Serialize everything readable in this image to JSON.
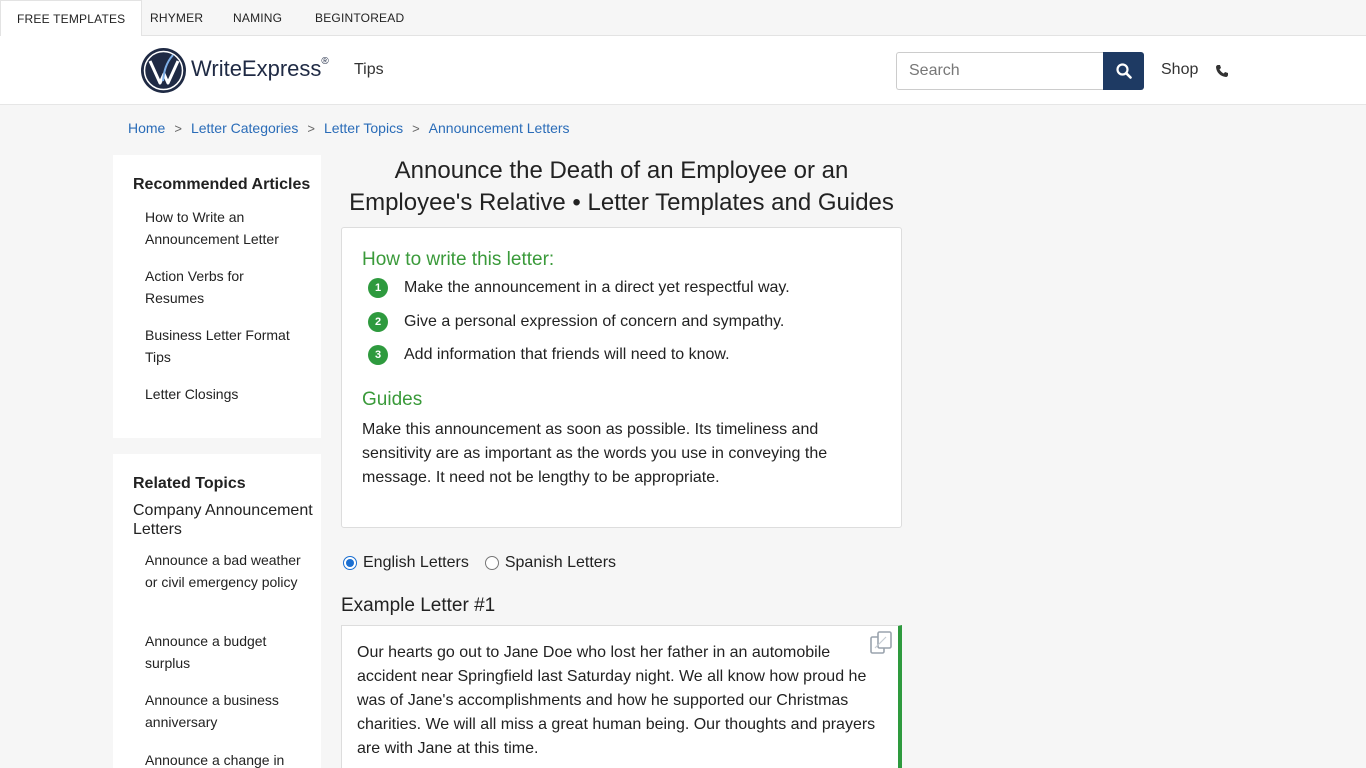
{
  "top_tabs": [
    "FREE TEMPLATES",
    "RHYMER",
    "NAMING",
    "BEGINTOREAD"
  ],
  "header": {
    "brand": "WriteExpress",
    "brand_mark": "®",
    "tips": "Tips",
    "search_placeholder": "Search",
    "shop": "Shop",
    "icons": {
      "search": "search-icon",
      "phone": "phone-icon",
      "logo": "quill-logo-icon"
    }
  },
  "breadcrumb": [
    "Home",
    "Letter Categories",
    "Letter Topics",
    "Announcement Letters"
  ],
  "sidebar": {
    "recommended": {
      "title": "Recommended Articles",
      "items": [
        "How to Write an Announcement Letter",
        "Action Verbs for Resumes",
        "Business Letter Format Tips",
        "Letter Closings"
      ]
    },
    "related": {
      "title": "Related Topics",
      "subheading": "Company Announcement Letters",
      "items": [
        "Announce a bad weather or civil emergency policy",
        "Announce a budget surplus",
        "Announce a business anniversary",
        "Announce a change in"
      ]
    }
  },
  "main": {
    "title": "Announce the Death of an Employee or an Employee's Relative • Letter Templates and Guides",
    "howto_heading": "How to write this letter:",
    "steps": [
      {
        "num": "1",
        "text": "Make the announcement in a direct yet respectful way."
      },
      {
        "num": "2",
        "text": "Give a personal expression of concern and sympathy."
      },
      {
        "num": "3",
        "text": "Add information that friends will need to know."
      }
    ],
    "guides_heading": "Guides",
    "guides_text": "Make this announcement as soon as possible. Its timeliness and sensitivity are as important as the words you use in conveying the message. It need not be lengthy to be appropriate.",
    "language_options": {
      "english": "English Letters",
      "spanish": "Spanish Letters",
      "selected": "English Letters"
    },
    "example_title": "Example Letter #1",
    "example_text": "Our hearts go out to Jane Doe who lost her father in an automobile accident near Springfield last Saturday night. We all know how proud he was of Jane's accomplishments and how he supported our Christmas charities. We will all miss a great human being. Our thoughts and prayers are with Jane at this time."
  },
  "colors": {
    "accent_green": "#2e9a3e",
    "link_blue": "#2a6cb8",
    "search_button": "#1e3a63"
  }
}
